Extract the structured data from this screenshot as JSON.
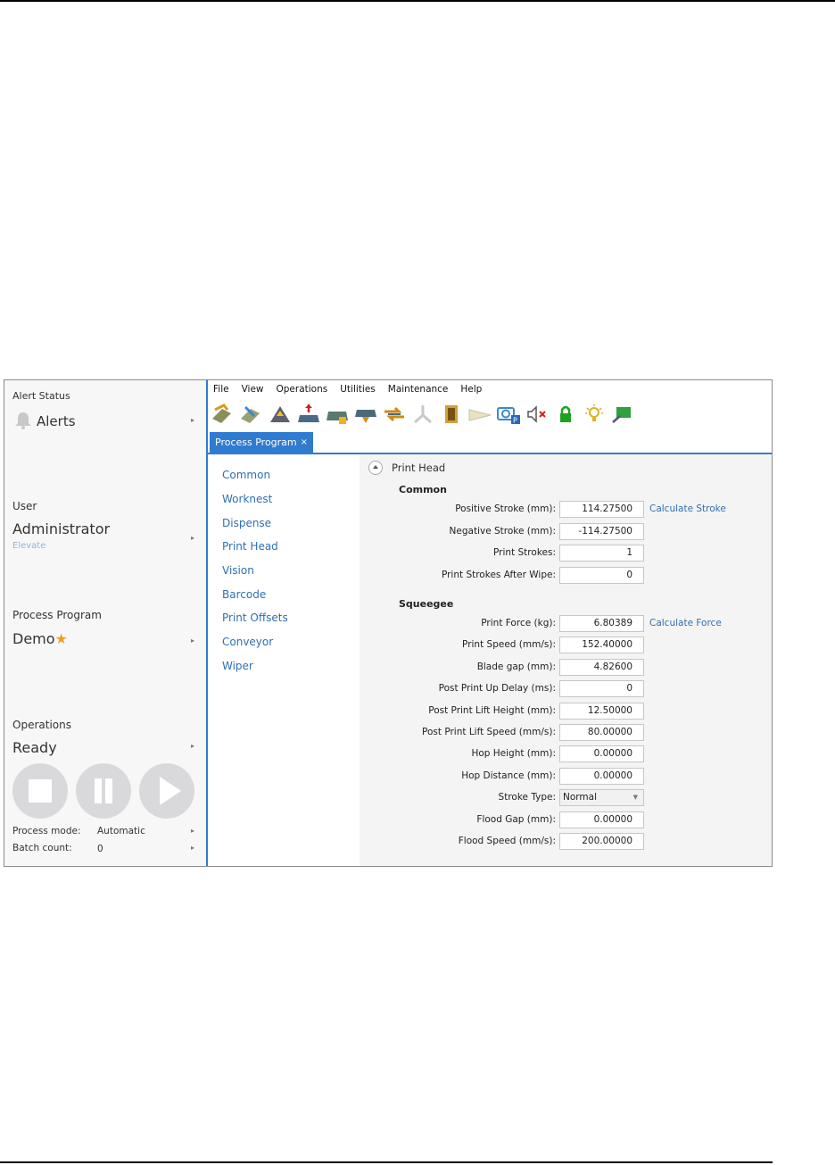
{
  "alerts": {
    "section": "Alert Status",
    "label": "Alerts"
  },
  "user": {
    "section": "User",
    "name": "Administrator",
    "elevate": "Elevate"
  },
  "process_program": {
    "section": "Process Program",
    "name": "Demo",
    "modified_mark": "★"
  },
  "operations": {
    "section": "Operations",
    "state": "Ready",
    "process_mode_label": "Process mode:",
    "process_mode_value": "Automatic",
    "batch_count_label": "Batch count:",
    "batch_count_value": "0"
  },
  "menu": [
    "File",
    "View",
    "Operations",
    "Utilities",
    "Maintenance",
    "Help"
  ],
  "toolbar_icons": [
    "load-board-icon",
    "unload-board-icon",
    "raise-table-icon",
    "board-in-icon",
    "board-transfer-icon",
    "board-out-icon",
    "cycle-icon",
    "squeegee-icon",
    "dispense-icon",
    "wiper-icon",
    "camera-p-icon",
    "mute-icon",
    "lock-icon",
    "light-icon",
    "monitor-icon"
  ],
  "tab": {
    "label": "Process Program",
    "close": "×"
  },
  "nav": [
    "Common",
    "Worknest",
    "Dispense",
    "Print Head",
    "Vision",
    "Barcode",
    "Print Offsets",
    "Conveyor",
    "Wiper"
  ],
  "section_title": "Print Head",
  "common": {
    "title": "Common",
    "fields": [
      {
        "label": "Positive Stroke (mm):",
        "value": "114.27500",
        "link": "Calculate Stroke"
      },
      {
        "label": "Negative Stroke (mm):",
        "value": "-114.27500"
      },
      {
        "label": "Print Strokes:",
        "value": "1"
      },
      {
        "label": "Print Strokes After Wipe:",
        "value": "0"
      }
    ]
  },
  "squeegee": {
    "title": "Squeegee",
    "fields": [
      {
        "label": "Print Force (kg):",
        "value": "6.80389",
        "link": "Calculate Force"
      },
      {
        "label": "Print Speed (mm/s):",
        "value": "152.40000"
      },
      {
        "label": "Blade gap (mm):",
        "value": "4.82600"
      },
      {
        "label": "Post Print Up Delay (ms):",
        "value": "0"
      },
      {
        "label": "Post Print Lift Height (mm):",
        "value": "12.50000"
      },
      {
        "label": "Post Print Lift Speed (mm/s):",
        "value": "80.00000"
      },
      {
        "label": "Hop Height (mm):",
        "value": "0.00000"
      },
      {
        "label": "Hop Distance (mm):",
        "value": "0.00000"
      },
      {
        "label": "Stroke Type:",
        "value": "Normal",
        "select": true
      },
      {
        "label": "Flood Gap (mm):",
        "value": "0.00000"
      },
      {
        "label": "Flood Speed (mm/s):",
        "value": "200.00000"
      }
    ]
  },
  "colors": {
    "accent": "#2f7bd0",
    "link": "#2f6fb5",
    "star": "#f0a020"
  }
}
